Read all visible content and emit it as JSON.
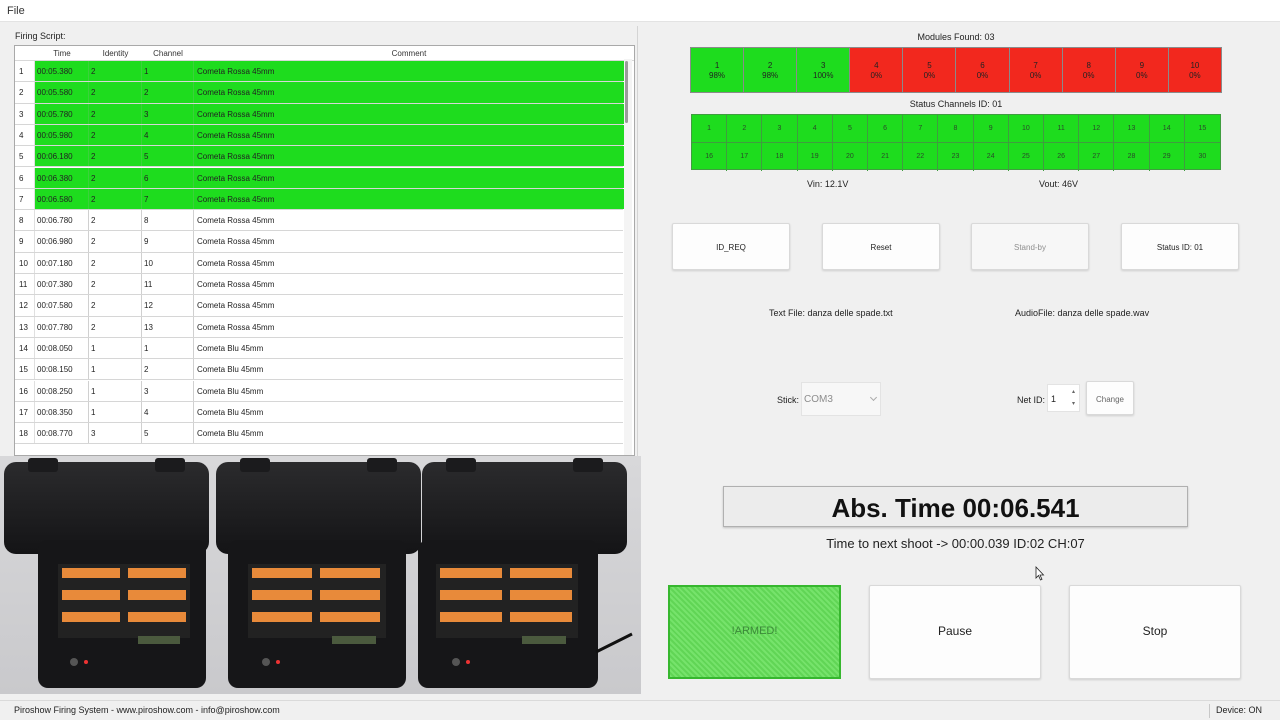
{
  "menu": {
    "file": "File"
  },
  "firing_script": {
    "label": "Firing Script:",
    "columns": [
      "Time",
      "Identity",
      "Channel",
      "Comment"
    ],
    "rows": [
      {
        "idx": "1",
        "time": "00:05.380",
        "identity": "2",
        "channel": "1",
        "comment": "Cometa Rossa 45mm",
        "fired": true
      },
      {
        "idx": "2",
        "time": "00:05.580",
        "identity": "2",
        "channel": "2",
        "comment": "Cometa Rossa 45mm",
        "fired": true
      },
      {
        "idx": "3",
        "time": "00:05.780",
        "identity": "2",
        "channel": "3",
        "comment": "Cometa Rossa 45mm",
        "fired": true
      },
      {
        "idx": "4",
        "time": "00:05.980",
        "identity": "2",
        "channel": "4",
        "comment": "Cometa Rossa 45mm",
        "fired": true
      },
      {
        "idx": "5",
        "time": "00:06.180",
        "identity": "2",
        "channel": "5",
        "comment": "Cometa Rossa 45mm",
        "fired": true
      },
      {
        "idx": "6",
        "time": "00:06.380",
        "identity": "2",
        "channel": "6",
        "comment": "Cometa Rossa 45mm",
        "fired": true
      },
      {
        "idx": "7",
        "time": "00:06.580",
        "identity": "2",
        "channel": "7",
        "comment": "Cometa Rossa 45mm",
        "fired": true
      },
      {
        "idx": "8",
        "time": "00:06.780",
        "identity": "2",
        "channel": "8",
        "comment": "Cometa Rossa 45mm",
        "fired": false
      },
      {
        "idx": "9",
        "time": "00:06.980",
        "identity": "2",
        "channel": "9",
        "comment": "Cometa Rossa 45mm",
        "fired": false
      },
      {
        "idx": "10",
        "time": "00:07.180",
        "identity": "2",
        "channel": "10",
        "comment": "Cometa Rossa 45mm",
        "fired": false
      },
      {
        "idx": "11",
        "time": "00:07.380",
        "identity": "2",
        "channel": "11",
        "comment": "Cometa Rossa 45mm",
        "fired": false
      },
      {
        "idx": "12",
        "time": "00:07.580",
        "identity": "2",
        "channel": "12",
        "comment": "Cometa Rossa 45mm",
        "fired": false
      },
      {
        "idx": "13",
        "time": "00:07.780",
        "identity": "2",
        "channel": "13",
        "comment": "Cometa Rossa 45mm",
        "fired": false
      },
      {
        "idx": "14",
        "time": "00:08.050",
        "identity": "1",
        "channel": "1",
        "comment": "Cometa Blu 45mm",
        "fired": false
      },
      {
        "idx": "15",
        "time": "00:08.150",
        "identity": "1",
        "channel": "2",
        "comment": "Cometa Blu 45mm",
        "fired": false
      },
      {
        "idx": "16",
        "time": "00:08.250",
        "identity": "1",
        "channel": "3",
        "comment": "Cometa Blu 45mm",
        "fired": false
      },
      {
        "idx": "17",
        "time": "00:08.350",
        "identity": "1",
        "channel": "4",
        "comment": "Cometa Blu 45mm",
        "fired": false
      },
      {
        "idx": "18",
        "time": "00:08.770",
        "identity": "3",
        "channel": "5",
        "comment": "Cometa Blu 45mm",
        "fired": false
      }
    ]
  },
  "modules": {
    "title": "Modules Found: 03",
    "items": [
      {
        "id": "1",
        "pct": "98%",
        "status": "ok"
      },
      {
        "id": "2",
        "pct": "98%",
        "status": "ok"
      },
      {
        "id": "3",
        "pct": "100%",
        "status": "ok"
      },
      {
        "id": "4",
        "pct": "0%",
        "status": "bad"
      },
      {
        "id": "5",
        "pct": "0%",
        "status": "bad"
      },
      {
        "id": "6",
        "pct": "0%",
        "status": "bad"
      },
      {
        "id": "7",
        "pct": "0%",
        "status": "bad"
      },
      {
        "id": "8",
        "pct": "0%",
        "status": "bad"
      },
      {
        "id": "9",
        "pct": "0%",
        "status": "bad"
      },
      {
        "id": "10",
        "pct": "0%",
        "status": "bad"
      }
    ]
  },
  "status_channels": {
    "title": "Status Channels ID: 01",
    "channels": [
      "1",
      "2",
      "3",
      "4",
      "5",
      "6",
      "7",
      "8",
      "9",
      "10",
      "11",
      "12",
      "13",
      "14",
      "15",
      "16",
      "17",
      "18",
      "19",
      "20",
      "21",
      "22",
      "23",
      "24",
      "25",
      "26",
      "27",
      "28",
      "29",
      "30"
    ]
  },
  "voltage": {
    "vin": "Vin: 12.1V",
    "vout": "Vout: 46V"
  },
  "buttons": {
    "id_req": "ID_REQ",
    "reset": "Reset",
    "standby": "Stand-by",
    "status_id": "Status ID: 01",
    "change": "Change",
    "armed": "!ARMED!",
    "pause": "Pause",
    "stop": "Stop"
  },
  "files": {
    "text_file": "Text File: danza delle spade.txt",
    "audio_file": "AudioFile: danza delle spade.wav"
  },
  "stick": {
    "label": "Stick:",
    "value": "COM3"
  },
  "net_id": {
    "label": "Net ID:",
    "value": "1"
  },
  "timer": {
    "abs_time": "Abs. Time 00:06.541",
    "next_shoot": "Time to next shoot -> 00:00.039  ID:02 CH:07"
  },
  "statusbar": {
    "left": "Piroshow Firing System - www.piroshow.com - info@piroshow.com",
    "right": "Device: ON"
  },
  "colors": {
    "fired_green": "#1edc1e",
    "module_bad_red": "#f2281e",
    "armed_green": "#66e05a"
  }
}
